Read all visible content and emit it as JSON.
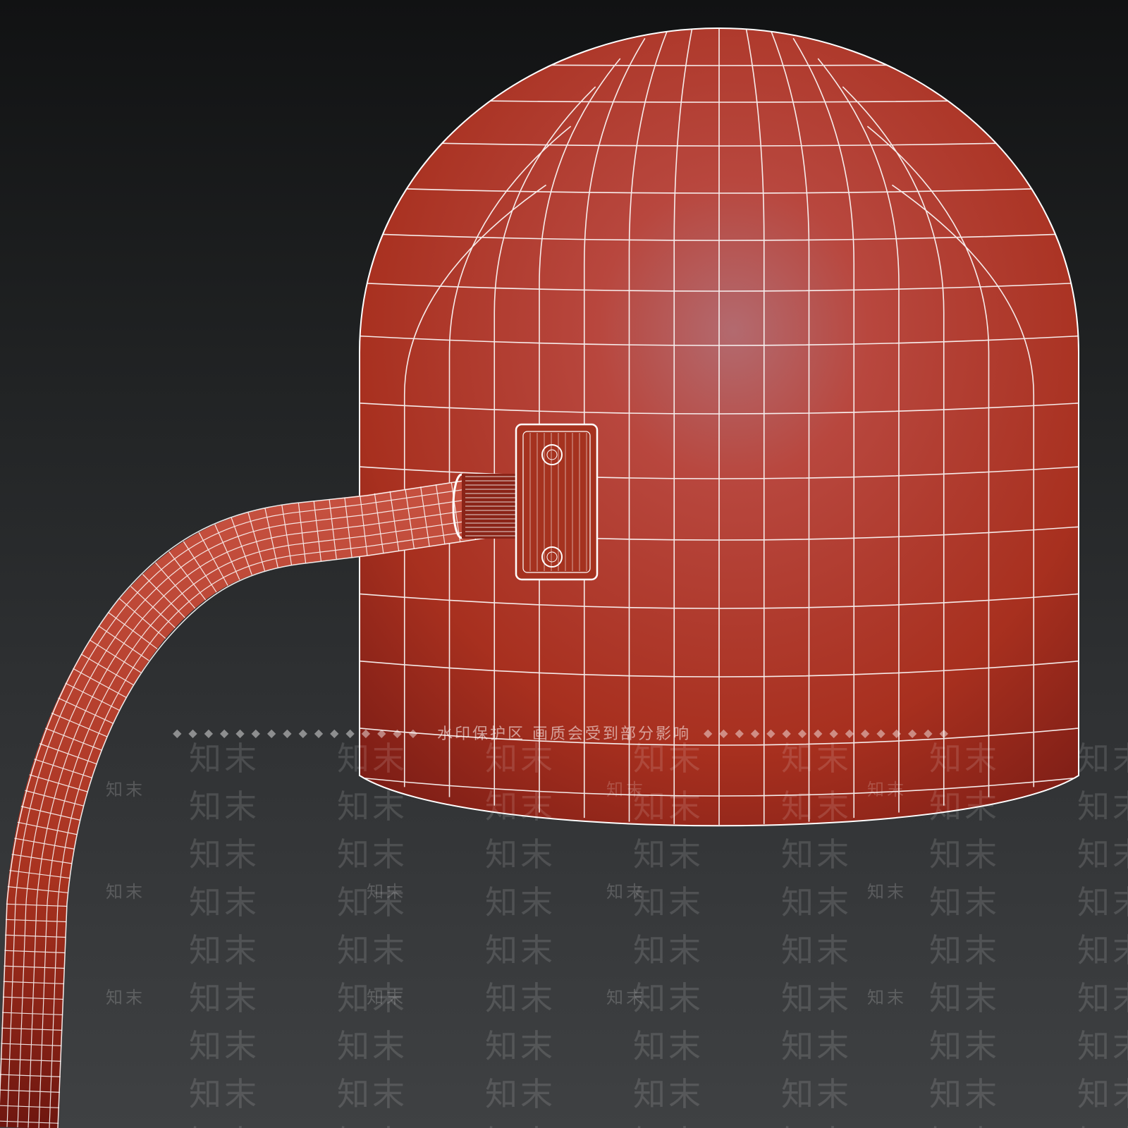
{
  "watermark": {
    "banner_text": "水印保护区  画质会受到部分影响",
    "brand_mark": "知末",
    "banner_dots": "◆◆◆◆◆◆◆◆◆◆◆◆◆◆◆◆"
  },
  "colors": {
    "shade_light": "#c9503f",
    "shade_mid": "#b7372b",
    "shade_dark": "#7e1e16",
    "wire": "#ffffff"
  }
}
